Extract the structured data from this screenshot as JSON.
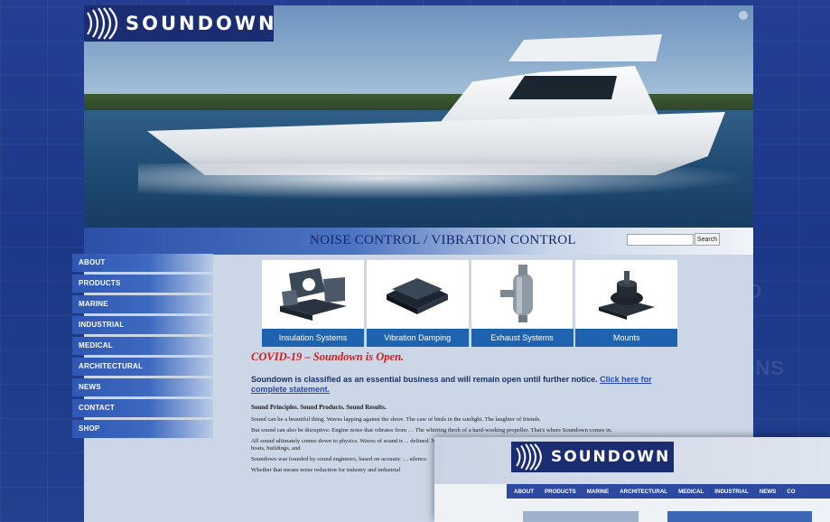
{
  "brand": {
    "wordmark": "SOUNDOWN"
  },
  "hero": {
    "tagline": "NOISE CONTROL / VIBRATION CONTROL"
  },
  "search": {
    "placeholder": "",
    "button_label": "Search"
  },
  "nav": {
    "items": [
      {
        "label": "ABOUT"
      },
      {
        "label": "PRODUCTS"
      },
      {
        "label": "MARINE"
      },
      {
        "label": "INDUSTRIAL"
      },
      {
        "label": "MEDICAL"
      },
      {
        "label": "ARCHITECTURAL"
      },
      {
        "label": "NEWS"
      },
      {
        "label": "CONTACT"
      },
      {
        "label": "SHOP"
      }
    ]
  },
  "tiles": [
    {
      "label": "Insulation Systems",
      "icon": "insulation-panels-icon"
    },
    {
      "label": "Vibration Damping",
      "icon": "damping-sheet-icon"
    },
    {
      "label": "Exhaust Systems",
      "icon": "exhaust-silencer-icon"
    },
    {
      "label": "Mounts",
      "icon": "engine-mount-icon"
    }
  ],
  "content": {
    "covid_heading": "COVID-19 – Soundown is Open.",
    "notice_text": "Soundown is classified as an essential business and will remain open until further notice. ",
    "notice_link": "Click here for complete statement.",
    "subheading": "Sound Principles. Sound Products. Sound Results.",
    "paragraphs": [
      "Sound can be a beautiful thing. Waves lapping against the shore. The caw of birds in the sunlight. The laughter of friends.",
      "But sound can also be disruptive. Engine noise that vibrates from  … The whirring throb of a hard-working propeller. That's where Soundown comes in.",
      "All sound ultimately comes down to physics. Waves of sound tr…  defined. Noise and vibration can be reduced, reflected, and con… products, you can solve noise problems on boats, buildings, and",
      "Soundown was founded by sound engineers, based on acoustic … silence.",
      "Whether that means noise reduction for industry and industrial"
    ]
  },
  "preview": {
    "wordmark": "SOUNDOWN",
    "nav": [
      "ABOUT",
      "PRODUCTS",
      "MARINE",
      "ARCHITECTURAL",
      "MEDICAL",
      "INDUSTRIAL",
      "NEWS",
      "CO"
    ]
  },
  "colors": {
    "background": "#1e3a8c",
    "nav_button": "#2f57b3",
    "tile_caption": "#1d63b0",
    "covid_red": "#d21c1c",
    "link": "#2848b8"
  }
}
